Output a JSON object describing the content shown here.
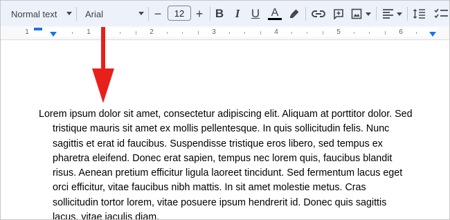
{
  "toolbar": {
    "style_value": "Normal text",
    "font_value": "Arial",
    "size_value": "12",
    "decrease_label": "−",
    "increase_label": "+",
    "bold_label": "B",
    "italic_label": "I",
    "underline_label": "U",
    "text_color_label": "A",
    "icons": [
      "minus-icon",
      "plus-icon",
      "bold-icon",
      "italic-icon",
      "underline-icon",
      "text-color-icon",
      "highlighter-icon",
      "link-icon",
      "add-comment-icon",
      "insert-image-icon",
      "align-icon",
      "line-spacing-icon",
      "checklist-icon"
    ]
  },
  "ruler": {
    "labels": [
      "1",
      "1",
      "2",
      "3",
      "4",
      "5",
      "6"
    ]
  },
  "document": {
    "paragraph_lines": [
      "Lorem ipsum dolor sit amet, consectetur adipiscing elit. Aliquam at porttitor dolor. Sed",
      "tristique mauris sit amet ex mollis pellentesque. In quis sollicitudin felis. Nunc",
      "sagittis et erat id faucibus. Suspendisse tristique eros libero, sed tempus ex",
      "pharetra eleifend. Donec erat sapien, tempus nec lorem quis, faucibus blandit",
      "risus. Aenean pretium efficitur ligula laoreet tincidunt. Sed fermentum lacus eget",
      "orci efficitur, vitae faucibus nibh mattis. In sit amet molestie metus. Cras",
      "sollicitudin tortor lorem, vitae posuere ipsum hendrerit id. Donec quis sagittis",
      "lacus, vitae iaculis diam."
    ]
  },
  "colors": {
    "toolbar_bg": "#edf2fa",
    "indent_marker": "#1a73e8",
    "annotation_arrow": "#e8201c",
    "text_color_bar": "#000000"
  }
}
